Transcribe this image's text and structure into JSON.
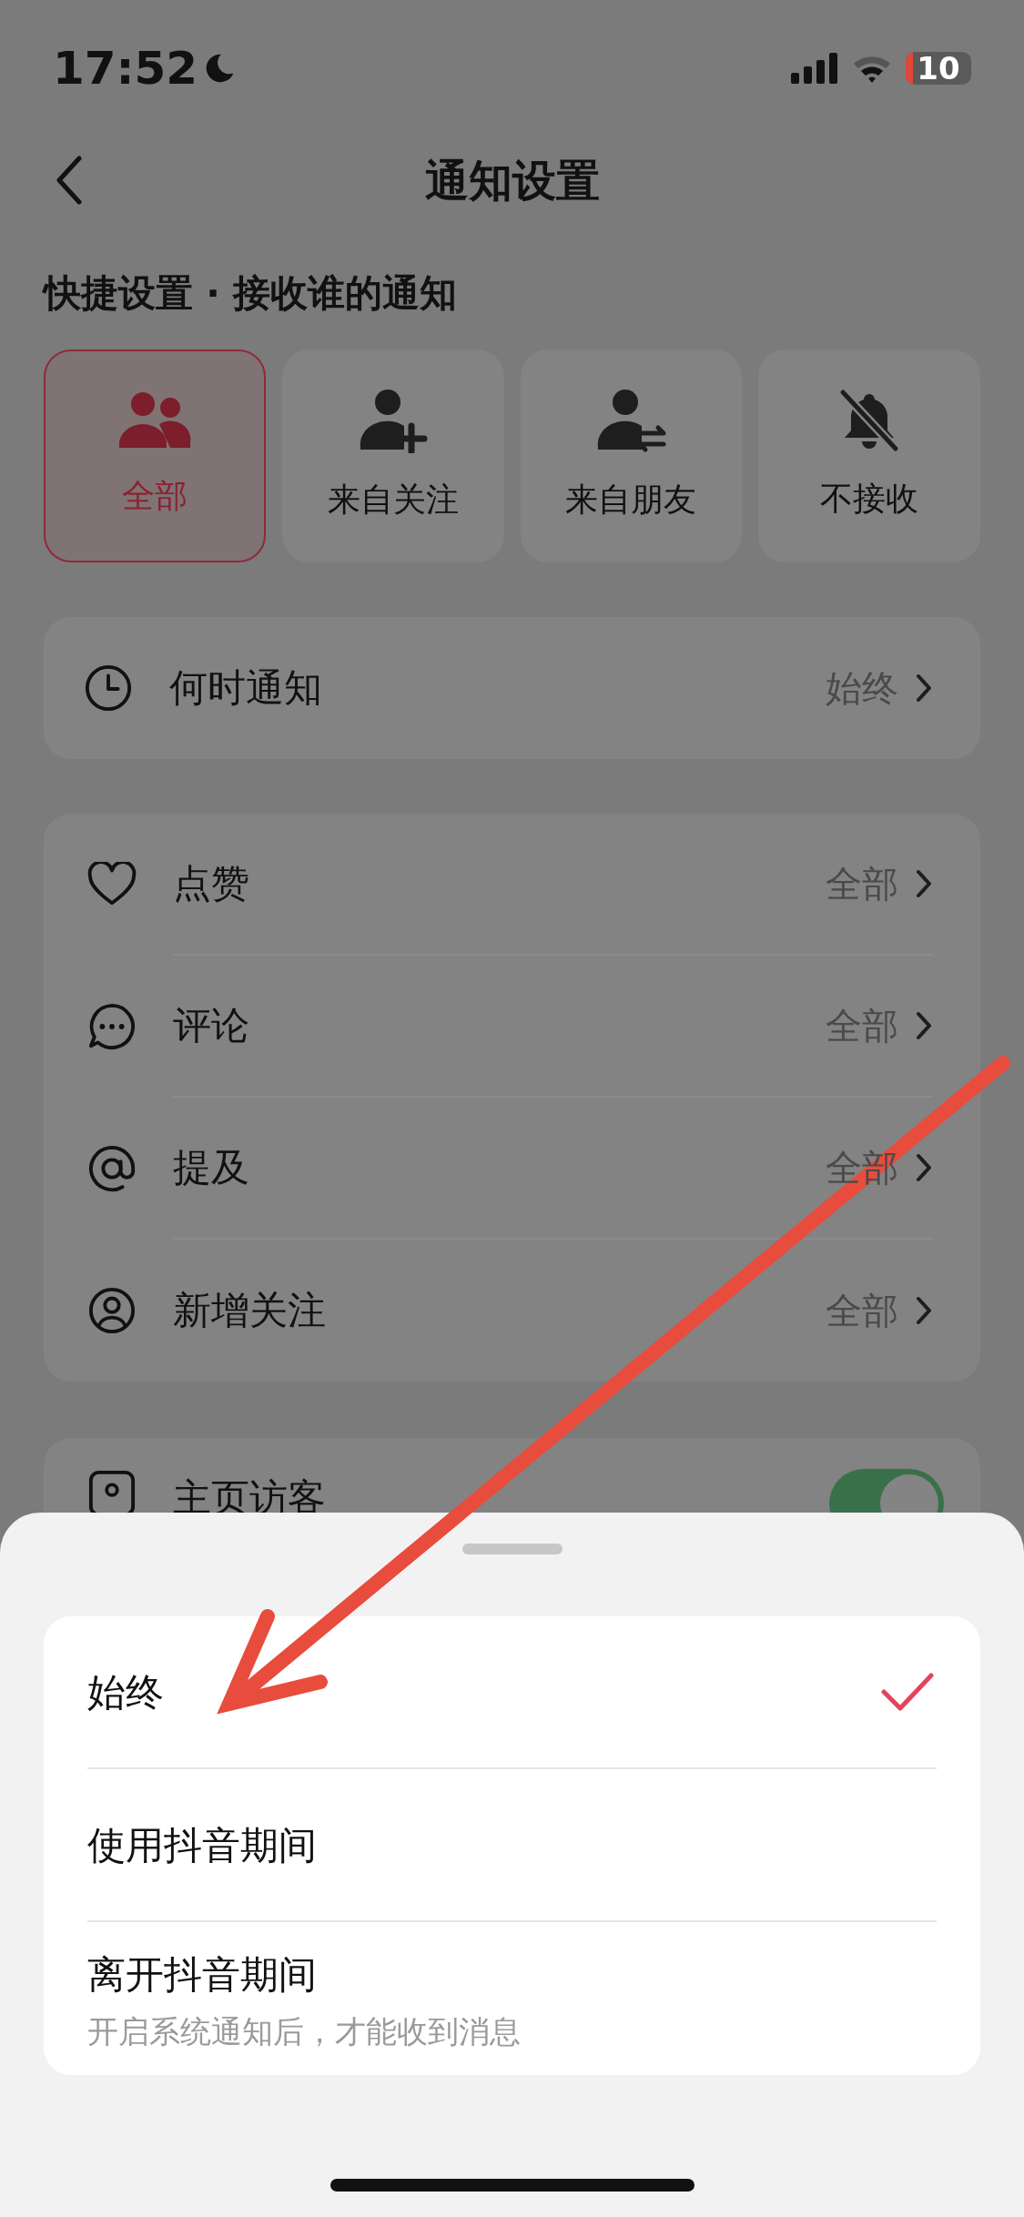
{
  "status_bar": {
    "time": "17:52",
    "battery": "10"
  },
  "nav": {
    "title": "通知设置"
  },
  "quick_settings": {
    "title": "快捷设置 · 接收谁的通知",
    "options": [
      {
        "label": "全部",
        "selected": true
      },
      {
        "label": "来自关注",
        "selected": false
      },
      {
        "label": "来自朋友",
        "selected": false
      },
      {
        "label": "不接收",
        "selected": false
      }
    ]
  },
  "when_row": {
    "label": "何时通知",
    "value": "始终"
  },
  "notify_rows": [
    {
      "label": "点赞",
      "value": "全部"
    },
    {
      "label": "评论",
      "value": "全部"
    },
    {
      "label": "提及",
      "value": "全部"
    },
    {
      "label": "新增关注",
      "value": "全部"
    }
  ],
  "visitor_row": {
    "label": "主页访客",
    "on": true
  },
  "sheet": {
    "options": [
      {
        "label": "始终",
        "selected": true
      },
      {
        "label": "使用抖音期间",
        "selected": false
      },
      {
        "label": "离开抖音期间",
        "selected": false,
        "subtitle": "开启系统通知后，才能收到消息"
      }
    ]
  }
}
